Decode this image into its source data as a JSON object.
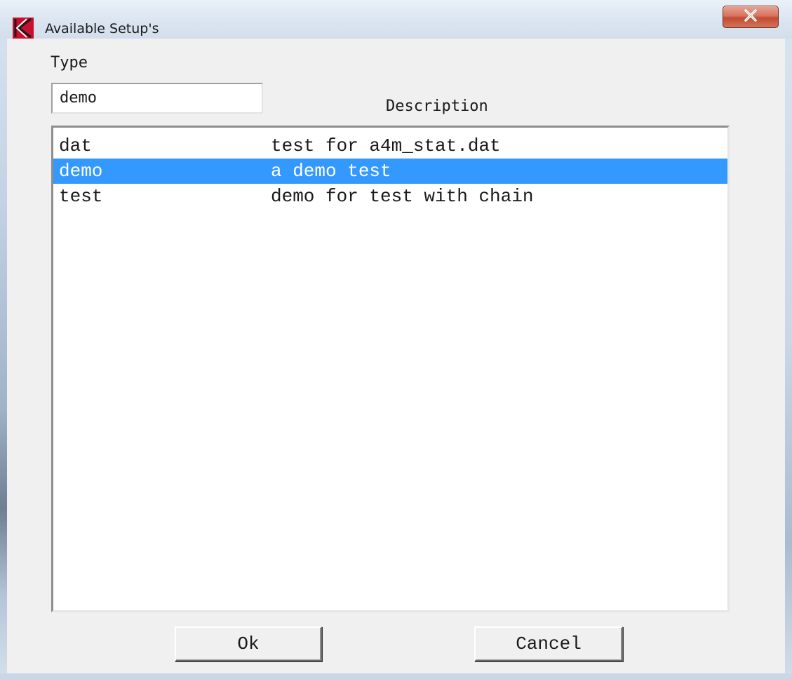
{
  "window": {
    "title": "Available Setup's",
    "app_icon": "k-logo-icon",
    "close_icon": "close-icon"
  },
  "form": {
    "type_label": "Type",
    "type_value": "demo",
    "description_label": "Description"
  },
  "setups": [
    {
      "type": "dat",
      "description": "test for a4m_stat.dat",
      "selected": false
    },
    {
      "type": "demo",
      "description": "a demo test",
      "selected": true
    },
    {
      "type": "test",
      "description": "demo for test with chain",
      "selected": false
    }
  ],
  "buttons": {
    "ok_label": "Ok",
    "cancel_label": "Cancel"
  },
  "colors": {
    "selection": "#3399ff",
    "close_button": "#c24b32",
    "icon_red": "#c8102e"
  }
}
